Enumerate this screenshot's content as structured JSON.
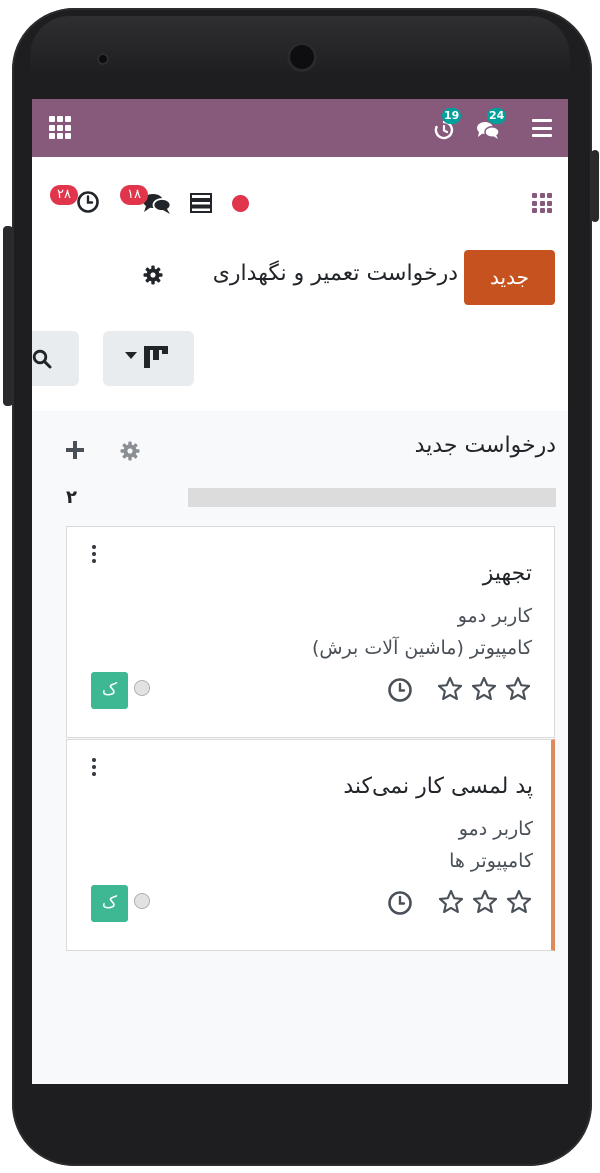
{
  "navbar": {
    "activity_badge": "19",
    "messages_badge": "24"
  },
  "controls": {
    "activities_badge": "۲۸",
    "messages_badge": "۱۸"
  },
  "header": {
    "new_label": "جدید",
    "title": "درخواست تعمیر و نگهداری"
  },
  "column": {
    "title": "درخواست جدید",
    "count": "۲",
    "progress": 0,
    "cards": [
      {
        "title": "تجهیز",
        "user": "کاربر دمو",
        "equipment": "کامپیوتر (ماشین آلات برش)",
        "avatar": "ک",
        "stars": 0
      },
      {
        "title": "پد لمسی کار نمی‌کند",
        "user": "کاربر دمو",
        "equipment": "کامپیوتر ها",
        "avatar": "ک",
        "stars": 0
      }
    ]
  },
  "colors": {
    "navbar": "#875a7b",
    "primary_button": "#c6531f",
    "badge_red": "#e0354a",
    "badge_teal": "#00a09d",
    "avatar": "#3db893",
    "card_accent": "#e08a5b"
  },
  "icons": [
    "apps-icon",
    "clock-icon",
    "chat-icon",
    "menu-icon",
    "list-icon",
    "gear-icon",
    "search-icon",
    "kanban-icon",
    "plus-icon",
    "star-icon",
    "kebab-icon"
  ]
}
